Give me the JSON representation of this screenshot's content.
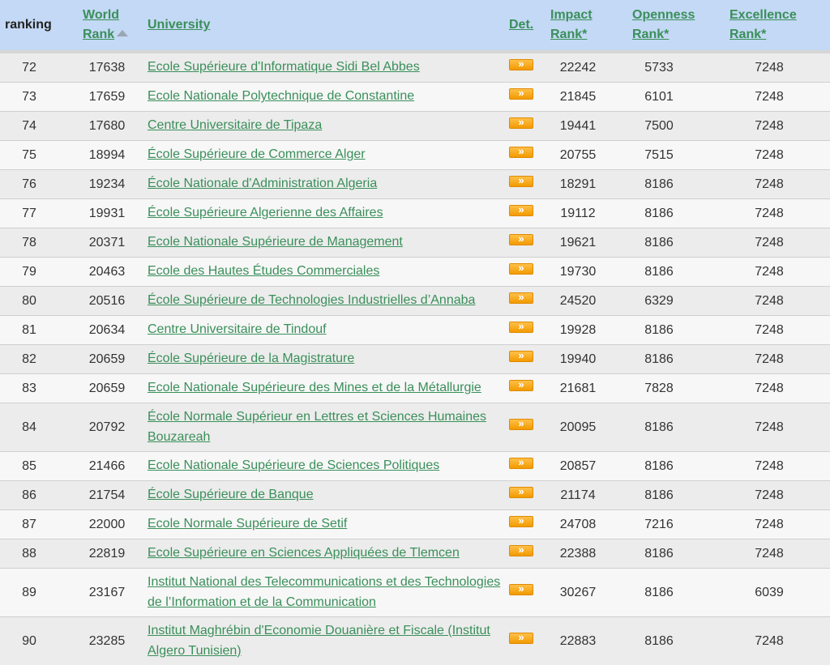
{
  "header": {
    "ranking": "ranking",
    "world_rank_line1": "World",
    "world_rank_line2": "Rank",
    "university": "University",
    "det": "Det.",
    "impact_line1": "Impact",
    "impact_line2": "Rank*",
    "openness_line1": "Openness",
    "openness_line2": "Rank*",
    "excellence_line1": "Excellence",
    "excellence_line2": "Rank*"
  },
  "rows": [
    {
      "ranking": "72",
      "world_rank": "17638",
      "university": "Ecole Supérieure d'Informatique Sidi Bel Abbes",
      "impact": "22242",
      "openness": "5733",
      "excellence": "7248"
    },
    {
      "ranking": "73",
      "world_rank": "17659",
      "university": "Ecole Nationale Polytechnique de Constantine",
      "impact": "21845",
      "openness": "6101",
      "excellence": "7248"
    },
    {
      "ranking": "74",
      "world_rank": "17680",
      "university": "Centre Universitaire de Tipaza",
      "impact": "19441",
      "openness": "7500",
      "excellence": "7248"
    },
    {
      "ranking": "75",
      "world_rank": "18994",
      "university": "École Supérieure de Commerce Alger",
      "impact": "20755",
      "openness": "7515",
      "excellence": "7248"
    },
    {
      "ranking": "76",
      "world_rank": "19234",
      "university": "École Nationale d'Administration Algeria",
      "impact": "18291",
      "openness": "8186",
      "excellence": "7248"
    },
    {
      "ranking": "77",
      "world_rank": "19931",
      "university": "École Supérieure Algerienne des Affaires",
      "impact": "19112",
      "openness": "8186",
      "excellence": "7248"
    },
    {
      "ranking": "78",
      "world_rank": "20371",
      "university": "Ecole Nationale Supérieure de Management",
      "impact": "19621",
      "openness": "8186",
      "excellence": "7248"
    },
    {
      "ranking": "79",
      "world_rank": "20463",
      "university": "Ecole des Hautes Études Commerciales",
      "impact": "19730",
      "openness": "8186",
      "excellence": "7248"
    },
    {
      "ranking": "80",
      "world_rank": "20516",
      "university": "École Supérieure de Technologies Industrielles d’Annaba",
      "impact": "24520",
      "openness": "6329",
      "excellence": "7248"
    },
    {
      "ranking": "81",
      "world_rank": "20634",
      "university": "Centre Universitaire de Tindouf",
      "impact": "19928",
      "openness": "8186",
      "excellence": "7248"
    },
    {
      "ranking": "82",
      "world_rank": "20659",
      "university": "École Supérieure de la Magistrature",
      "impact": "19940",
      "openness": "8186",
      "excellence": "7248"
    },
    {
      "ranking": "83",
      "world_rank": "20659",
      "university": "Ecole Nationale Supérieure des Mines et de la Métallurgie",
      "impact": "21681",
      "openness": "7828",
      "excellence": "7248"
    },
    {
      "ranking": "84",
      "world_rank": "20792",
      "university": "École Normale Supérieur en Lettres et Sciences Humaines Bouzareah",
      "impact": "20095",
      "openness": "8186",
      "excellence": "7248"
    },
    {
      "ranking": "85",
      "world_rank": "21466",
      "university": "Ecole Nationale Supérieure de Sciences Politiques",
      "impact": "20857",
      "openness": "8186",
      "excellence": "7248"
    },
    {
      "ranking": "86",
      "world_rank": "21754",
      "university": "École Supérieure de Banque",
      "impact": "21174",
      "openness": "8186",
      "excellence": "7248"
    },
    {
      "ranking": "87",
      "world_rank": "22000",
      "university": "Ecole Normale Supérieure de Setif",
      "impact": "24708",
      "openness": "7216",
      "excellence": "7248"
    },
    {
      "ranking": "88",
      "world_rank": "22819",
      "university": "Ecole Supérieure en Sciences Appliquées de Tlemcen",
      "impact": "22388",
      "openness": "8186",
      "excellence": "7248"
    },
    {
      "ranking": "89",
      "world_rank": "23167",
      "university": "Institut National des Telecommunications et des Technologies de l’Information et de la Communication",
      "impact": "30267",
      "openness": "8186",
      "excellence": "6039"
    },
    {
      "ranking": "90",
      "world_rank": "23285",
      "university": "Institut Maghrébin d'Economie Douanière et Fiscale (Institut Algero Tunisien)",
      "impact": "22883",
      "openness": "8186",
      "excellence": "7248"
    }
  ]
}
